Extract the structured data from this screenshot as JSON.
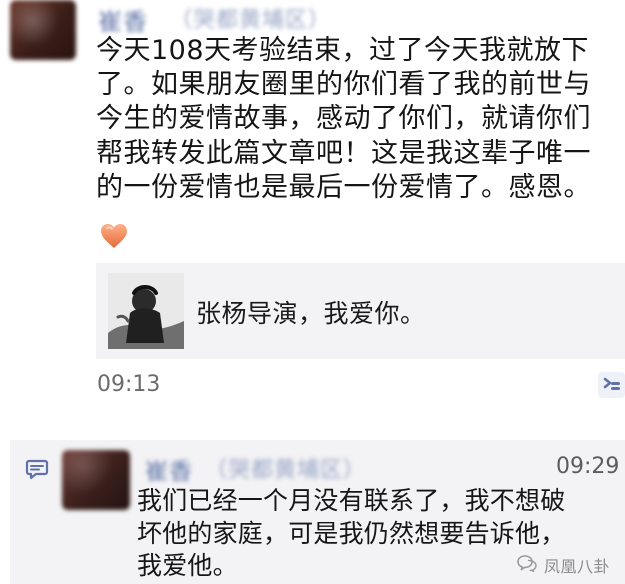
{
  "post": {
    "author_name_blurred": "崔香",
    "author_meta_blurred": "（哭都黄埔区）",
    "text": "今天108天考验结束，过了今天我就放下\n了。如果朋友圈里的你们看了我的前世与\n今生的爱情故事，感动了你们，就请你们\n帮我转发此篇文章吧！这是我这辈子唯一\n的一份爱情也是最后一份爱情了。感恩。",
    "heart_icon": "heart-icon",
    "share_card": {
      "title": "张杨导演，我爱你。"
    },
    "time": "09:13"
  },
  "comment": {
    "author_name_blurred": "崔香",
    "author_meta_blurred": "（哭都黄埔区）",
    "time": "09:29",
    "text": "我们已经一个月没有联系了，我不想破\n坏他的家庭，可是我仍然想要告诉他，\n我爱他。"
  },
  "watermark": {
    "text": "凤凰八卦"
  },
  "colors": {
    "name": "#5f73a8",
    "meta": "#9aa6c6",
    "heart": "#f08a5d",
    "card_bg": "#f3f3f5",
    "comment_bg": "#f3f3f5"
  }
}
